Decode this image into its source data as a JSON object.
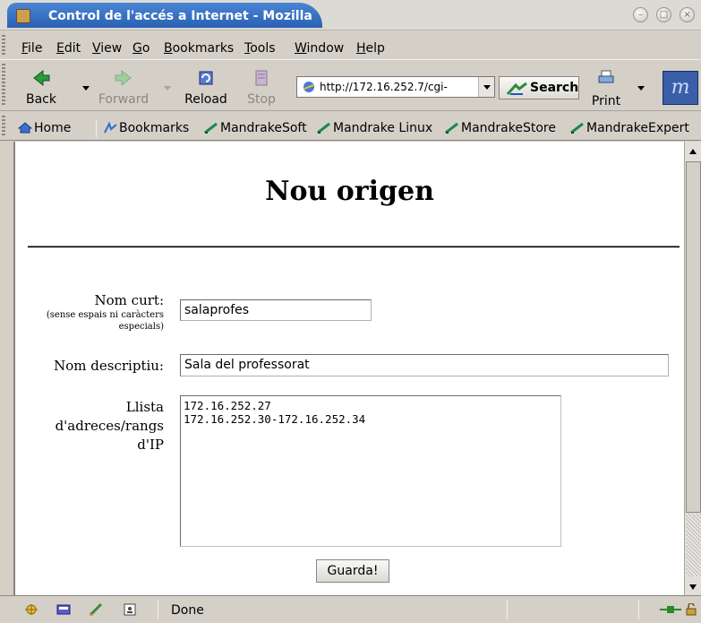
{
  "window": {
    "title": "Control de l'accés a Internet - Mozilla"
  },
  "menu": [
    {
      "label": "File",
      "key": "F"
    },
    {
      "label": "Edit",
      "key": "E"
    },
    {
      "label": "View",
      "key": "V"
    },
    {
      "label": "Go",
      "key": "G"
    },
    {
      "label": "Bookmarks",
      "key": "B"
    },
    {
      "label": "Tools",
      "key": "T"
    },
    {
      "label": "Window",
      "key": "W"
    },
    {
      "label": "Help",
      "key": "H"
    }
  ],
  "toolbar": {
    "back": "Back",
    "forward": "Forward",
    "reload": "Reload",
    "stop": "Stop",
    "url": "http://172.16.252.7/cgi-",
    "search": "Search",
    "print": "Print"
  },
  "personal_toolbar": [
    {
      "label": "Home",
      "icon": "home-icon"
    },
    {
      "label": "Bookmarks",
      "icon": "bookmarks-icon"
    },
    {
      "label": "MandrakeSoft",
      "icon": "mandrake-icon"
    },
    {
      "label": "Mandrake Linux",
      "icon": "mandrake-icon"
    },
    {
      "label": "MandrakeStore",
      "icon": "mandrake-icon"
    },
    {
      "label": "MandrakeExpert",
      "icon": "mandrake-icon"
    }
  ],
  "page": {
    "title": "Nou origen",
    "form": {
      "short_name_label": "Nom curt:",
      "short_name_note": "(sense espais ni caràcters especials)",
      "short_name_value": "salaprofes",
      "desc_label": "Nom descriptiu:",
      "desc_value": "Sala del professorat",
      "ip_label": "Llista d'adreces/rangs d'IP",
      "ip_value": "172.16.252.27\n172.16.252.30-172.16.252.34",
      "submit": "Guarda!"
    }
  },
  "status": {
    "text": "Done"
  },
  "colors": {
    "titlebar": "#2a60b4",
    "chrome": "#d4d0c8",
    "content_bg": "#ffffff"
  }
}
